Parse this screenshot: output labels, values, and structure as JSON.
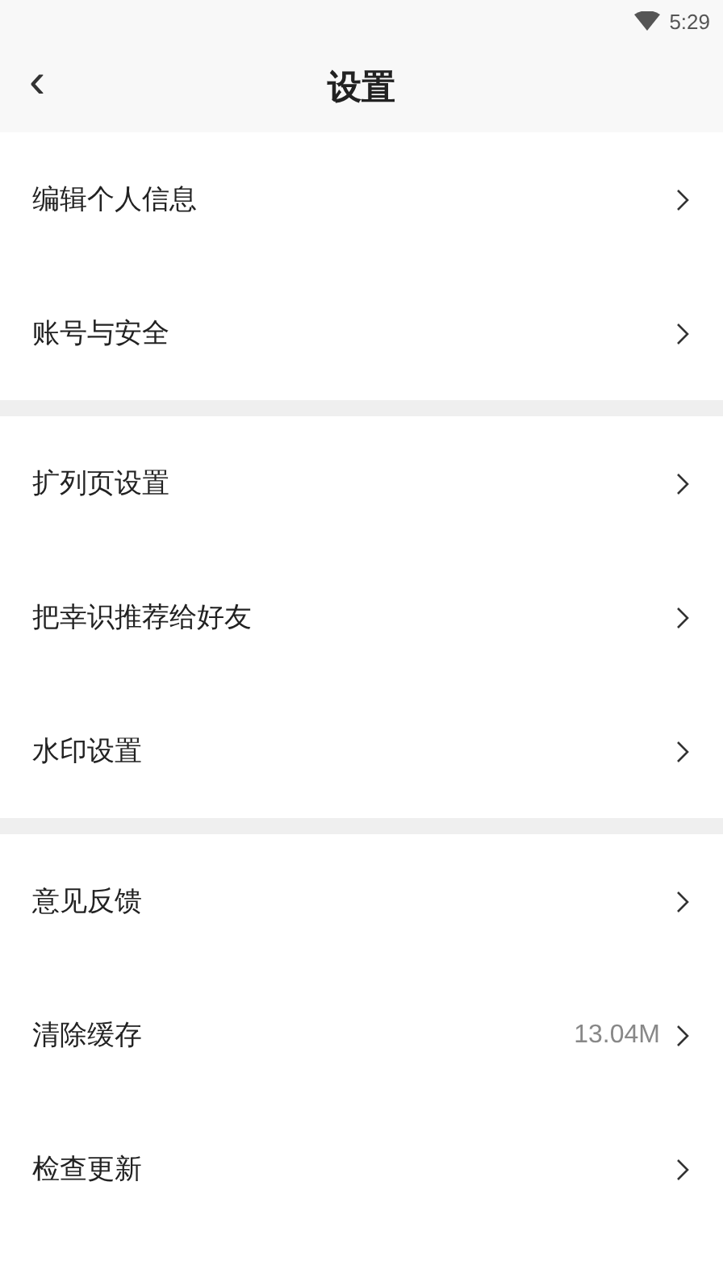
{
  "status_bar": {
    "time": "5:29"
  },
  "header": {
    "back": "‹",
    "title": "设置"
  },
  "groups": [
    {
      "items": [
        {
          "label": "编辑个人信息"
        },
        {
          "label": "账号与安全"
        }
      ]
    },
    {
      "items": [
        {
          "label": "扩列页设置"
        },
        {
          "label": "把幸识推荐给好友"
        },
        {
          "label": "水印设置"
        }
      ]
    },
    {
      "items": [
        {
          "label": "意见反馈"
        },
        {
          "label": "清除缓存",
          "value": "13.04M"
        },
        {
          "label": "检查更新"
        }
      ]
    }
  ]
}
